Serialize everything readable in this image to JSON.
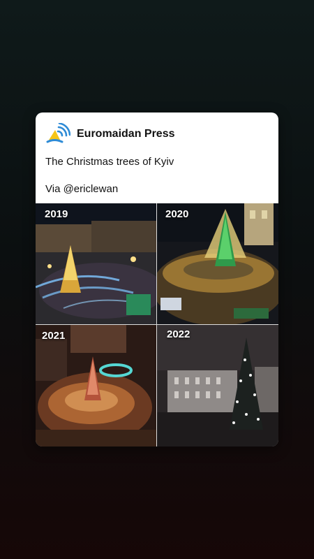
{
  "post": {
    "publisher": "Euromaidan Press",
    "caption": "The Christmas trees of Kyiv",
    "credit": "Via @ericlewan",
    "colors": {
      "logo_blue": "#2e8bd6",
      "logo_yellow": "#f5c518"
    },
    "logo_icon": "euromaidan-broadcast-logo"
  },
  "tiles": [
    {
      "year": "2019"
    },
    {
      "year": "2020"
    },
    {
      "year": "2021"
    },
    {
      "year": "2022"
    }
  ]
}
